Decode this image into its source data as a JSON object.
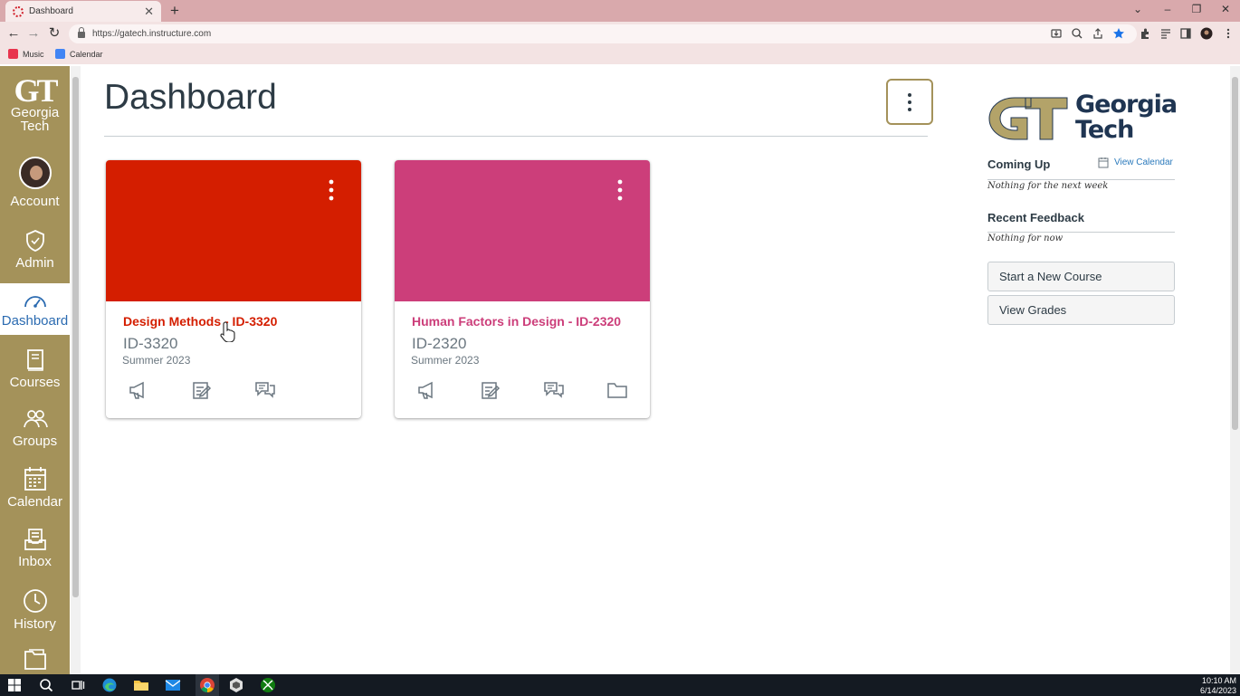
{
  "browser": {
    "tab_title": "Dashboard",
    "url": "https://gatech.instructure.com",
    "bookmarks": [
      {
        "label": "Music",
        "icon": "music-icon",
        "color": "#e8344e"
      },
      {
        "label": "Calendar",
        "icon": "calendar-icon",
        "color": "#4285f4"
      }
    ]
  },
  "global_nav": {
    "logo_top": "GT",
    "logo_line1": "Georgia",
    "logo_line2": "Tech",
    "items": [
      {
        "label": "Account",
        "icon": "avatar"
      },
      {
        "label": "Admin",
        "icon": "shield-icon"
      },
      {
        "label": "Dashboard",
        "icon": "speedometer-icon",
        "active": true
      },
      {
        "label": "Courses",
        "icon": "book-icon"
      },
      {
        "label": "Groups",
        "icon": "people-icon"
      },
      {
        "label": "Calendar",
        "icon": "calendar-icon"
      },
      {
        "label": "Inbox",
        "icon": "inbox-icon"
      },
      {
        "label": "History",
        "icon": "clock-icon"
      },
      {
        "label": "",
        "icon": "folder-icon"
      }
    ],
    "colors": {
      "background": "#a4925a",
      "active_text": "#2b6bb1"
    }
  },
  "main": {
    "title": "Dashboard",
    "cards": [
      {
        "title": "Design Methods - ID-3320",
        "code": "ID-3320",
        "term": "Summer 2023",
        "color": "#d41e00",
        "actions": [
          "announcements-icon",
          "assignments-icon",
          "discussions-icon"
        ]
      },
      {
        "title": "Human Factors in Design - ID-2320",
        "code": "ID-2320",
        "term": "Summer 2023",
        "color": "#cc3e7a",
        "actions": [
          "announcements-icon",
          "assignments-icon",
          "discussions-icon",
          "files-icon"
        ]
      }
    ]
  },
  "sidebar": {
    "logo_word1": "Georgia",
    "logo_word2": "Tech",
    "coming_up": {
      "heading": "Coming Up",
      "link": "View Calendar",
      "empty": "Nothing for the next week"
    },
    "recent_feedback": {
      "heading": "Recent Feedback",
      "empty": "Nothing for now"
    },
    "buttons": [
      "Start a New Course",
      "View Grades"
    ]
  },
  "taskbar": {
    "time": "10:10 AM",
    "date": "6/14/2023"
  }
}
